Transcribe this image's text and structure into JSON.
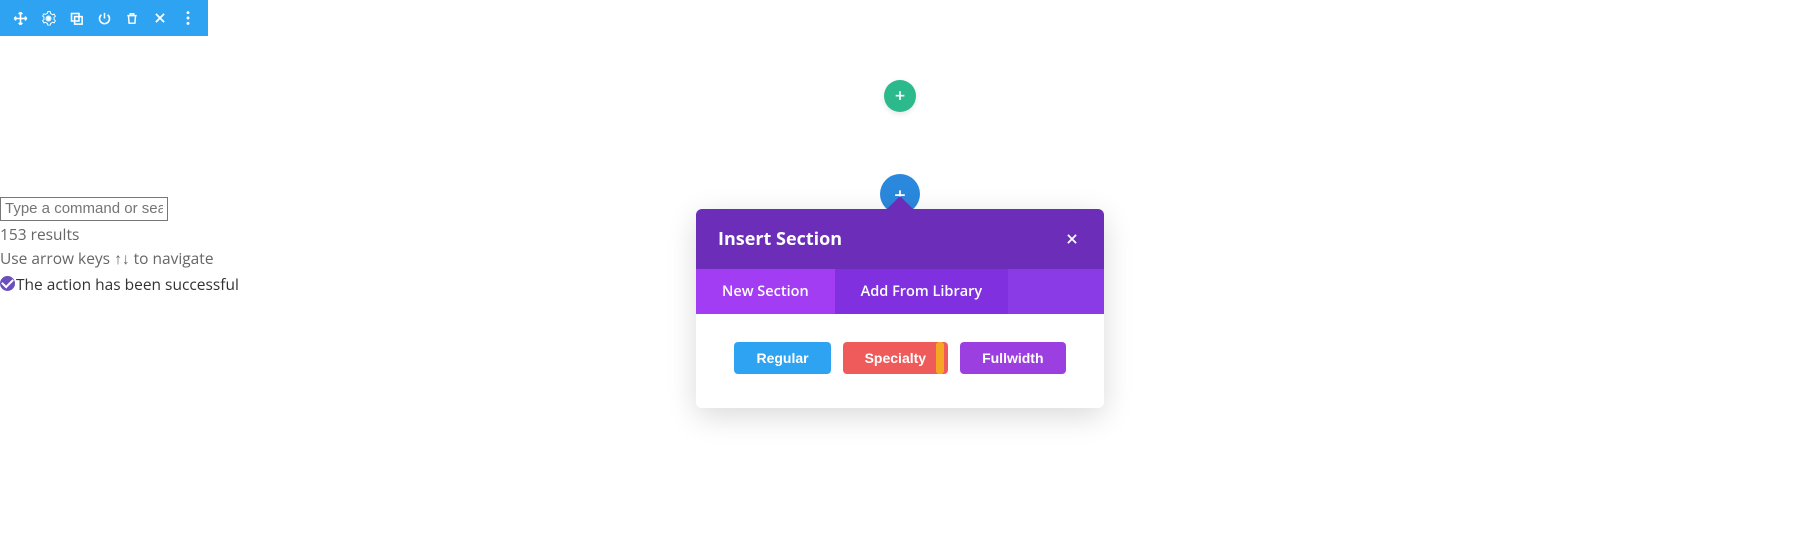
{
  "toolbar": {
    "icons": [
      "move",
      "gear",
      "duplicate",
      "power",
      "trash",
      "close",
      "more"
    ]
  },
  "add_buttons": {
    "green_plus": "+",
    "blue_plus": "+"
  },
  "palette": {
    "placeholder": "Type a command or searc",
    "results": "153 results",
    "hint": "Use arrow keys ↑↓ to navigate",
    "success": "The action has been successful"
  },
  "modal": {
    "title": "Insert Section",
    "tabs": {
      "new_section": "New Section",
      "add_from_library": "Add From Library"
    },
    "options": {
      "regular": "Regular",
      "specialty": "Specialty",
      "fullwidth": "Fullwidth"
    }
  }
}
